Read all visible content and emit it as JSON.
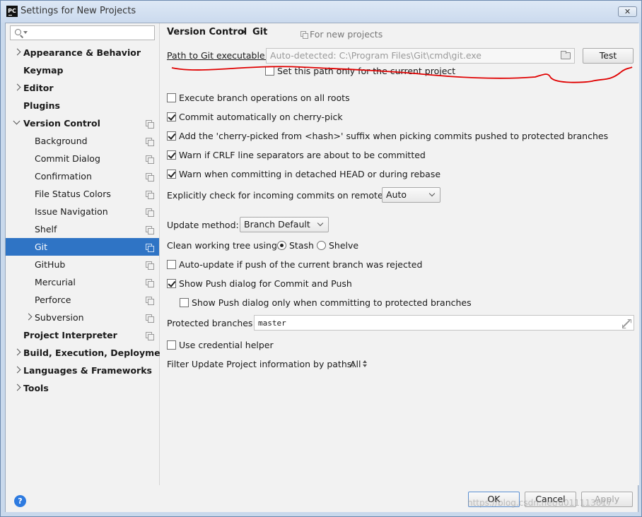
{
  "window": {
    "app_icon": "PC",
    "title": "Settings for New Projects",
    "close_glyph": "✕"
  },
  "sidebar": {
    "search": {
      "placeholder": "",
      "value": ""
    },
    "items": [
      {
        "label": "Appearance & Behavior",
        "level": 0,
        "arrow": "right",
        "bold": true
      },
      {
        "label": "Keymap",
        "level": 0,
        "arrow": "none",
        "bold": true
      },
      {
        "label": "Editor",
        "level": 0,
        "arrow": "right",
        "bold": true
      },
      {
        "label": "Plugins",
        "level": 0,
        "arrow": "none",
        "bold": true
      },
      {
        "label": "Version Control",
        "level": 0,
        "arrow": "down",
        "bold": true,
        "copy_icon": true
      },
      {
        "label": "Background",
        "level": 1,
        "copy_icon": true
      },
      {
        "label": "Commit Dialog",
        "level": 1,
        "copy_icon": true
      },
      {
        "label": "Confirmation",
        "level": 1,
        "copy_icon": true
      },
      {
        "label": "File Status Colors",
        "level": 1,
        "copy_icon": true
      },
      {
        "label": "Issue Navigation",
        "level": 1,
        "copy_icon": true
      },
      {
        "label": "Shelf",
        "level": 1,
        "copy_icon": true
      },
      {
        "label": "Git",
        "level": 1,
        "copy_icon": true,
        "selected": true
      },
      {
        "label": "GitHub",
        "level": 1,
        "copy_icon": true
      },
      {
        "label": "Mercurial",
        "level": 1,
        "copy_icon": true
      },
      {
        "label": "Perforce",
        "level": 1,
        "copy_icon": true
      },
      {
        "label": "Subversion",
        "level": 1,
        "arrow": "right",
        "copy_icon": true
      },
      {
        "label": "Project Interpreter",
        "level": 0,
        "arrow": "none",
        "bold": true,
        "copy_icon": true
      },
      {
        "label": "Build, Execution, Deployment",
        "level": 0,
        "arrow": "right",
        "bold": true
      },
      {
        "label": "Languages & Frameworks",
        "level": 0,
        "arrow": "right",
        "bold": true
      },
      {
        "label": "Tools",
        "level": 0,
        "arrow": "right",
        "bold": true
      }
    ]
  },
  "panel": {
    "breadcrumb": {
      "parent": "Version Control",
      "separator": "›",
      "current": "Git"
    },
    "for_new_projects": "For new projects",
    "git_path": {
      "label": "Path to Git executable:",
      "value": "Auto-detected: C:\\Program Files\\Git\\cmd\\git.exe",
      "test_button": "Test",
      "current_project_only": {
        "label": "Set this path only for the current project",
        "checked": false
      }
    },
    "options": {
      "execute_all_roots": {
        "label": "Execute branch operations on all roots",
        "checked": false
      },
      "commit_cherry_pick": {
        "label": "Commit automatically on cherry-pick",
        "checked": true
      },
      "cherry_suffix": {
        "label": "Add the 'cherry-picked from <hash>' suffix when picking commits pushed to protected branches",
        "checked": true
      },
      "warn_crlf": {
        "label": "Warn if CRLF line separators are about to be committed",
        "checked": true
      },
      "warn_detached": {
        "label": "Warn when committing in detached HEAD or during rebase",
        "checked": true
      }
    },
    "incoming": {
      "label": "Explicitly check for incoming commits on remotes:",
      "value": "Auto"
    },
    "update_method": {
      "label": "Update method:",
      "value": "Branch Default"
    },
    "clean_tree": {
      "label": "Clean working tree using:",
      "stash": "Stash",
      "shelve": "Shelve",
      "selected": "stash"
    },
    "auto_update": {
      "label": "Auto-update if push of the current branch was rejected",
      "checked": false
    },
    "show_push": {
      "label": "Show Push dialog for Commit and Push",
      "checked": true
    },
    "show_push_protected": {
      "label": "Show Push dialog only when committing to protected branches",
      "checked": false
    },
    "protected_branches": {
      "label": "Protected branches:",
      "value": "master"
    },
    "credential_helper": {
      "label": "Use credential helper",
      "checked": false
    },
    "filter_update": {
      "label": "Filter Update Project information by paths:",
      "value": "All"
    }
  },
  "footer": {
    "help_glyph": "?",
    "ok": "OK",
    "cancel": "Cancel",
    "apply": "Apply"
  },
  "watermark": "https://blog.csdn.net/u011113617",
  "annotation_color": "#e00000"
}
